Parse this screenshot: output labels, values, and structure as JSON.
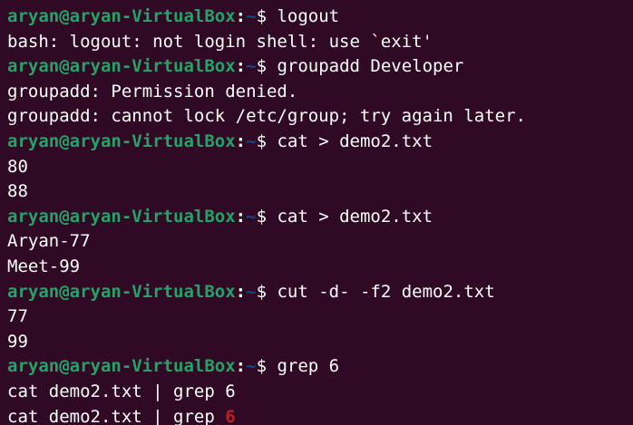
{
  "colors": {
    "background": "#300a24",
    "prompt_user": "#26a269",
    "prompt_path": "#12488b",
    "text": "#ffffff",
    "grep_match": "#c01c28"
  },
  "prompt": {
    "user_host": "aryan@aryan-VirtualBox",
    "colon": ":",
    "path": "~",
    "symbol": "$ "
  },
  "lines": [
    {
      "type": "prompt",
      "cmd": "logout"
    },
    {
      "type": "output",
      "text": "bash: logout: not login shell: use `exit'"
    },
    {
      "type": "prompt",
      "cmd": "groupadd Developer"
    },
    {
      "type": "output",
      "text": "groupadd: Permission denied."
    },
    {
      "type": "output",
      "text": "groupadd: cannot lock /etc/group; try again later."
    },
    {
      "type": "prompt",
      "cmd": "cat > demo2.txt"
    },
    {
      "type": "output",
      "text": "80"
    },
    {
      "type": "output",
      "text": "88"
    },
    {
      "type": "prompt",
      "cmd": "cat > demo2.txt"
    },
    {
      "type": "output",
      "text": "Aryan-77"
    },
    {
      "type": "output",
      "text": "Meet-99"
    },
    {
      "type": "prompt",
      "cmd": "cut -d- -f2 demo2.txt"
    },
    {
      "type": "output",
      "text": "77"
    },
    {
      "type": "output",
      "text": "99"
    },
    {
      "type": "prompt",
      "cmd": "grep 6"
    },
    {
      "type": "output",
      "text": "cat demo2.txt | grep 6"
    },
    {
      "type": "match",
      "text": "cat demo2.txt | grep ",
      "highlight": "6"
    }
  ]
}
